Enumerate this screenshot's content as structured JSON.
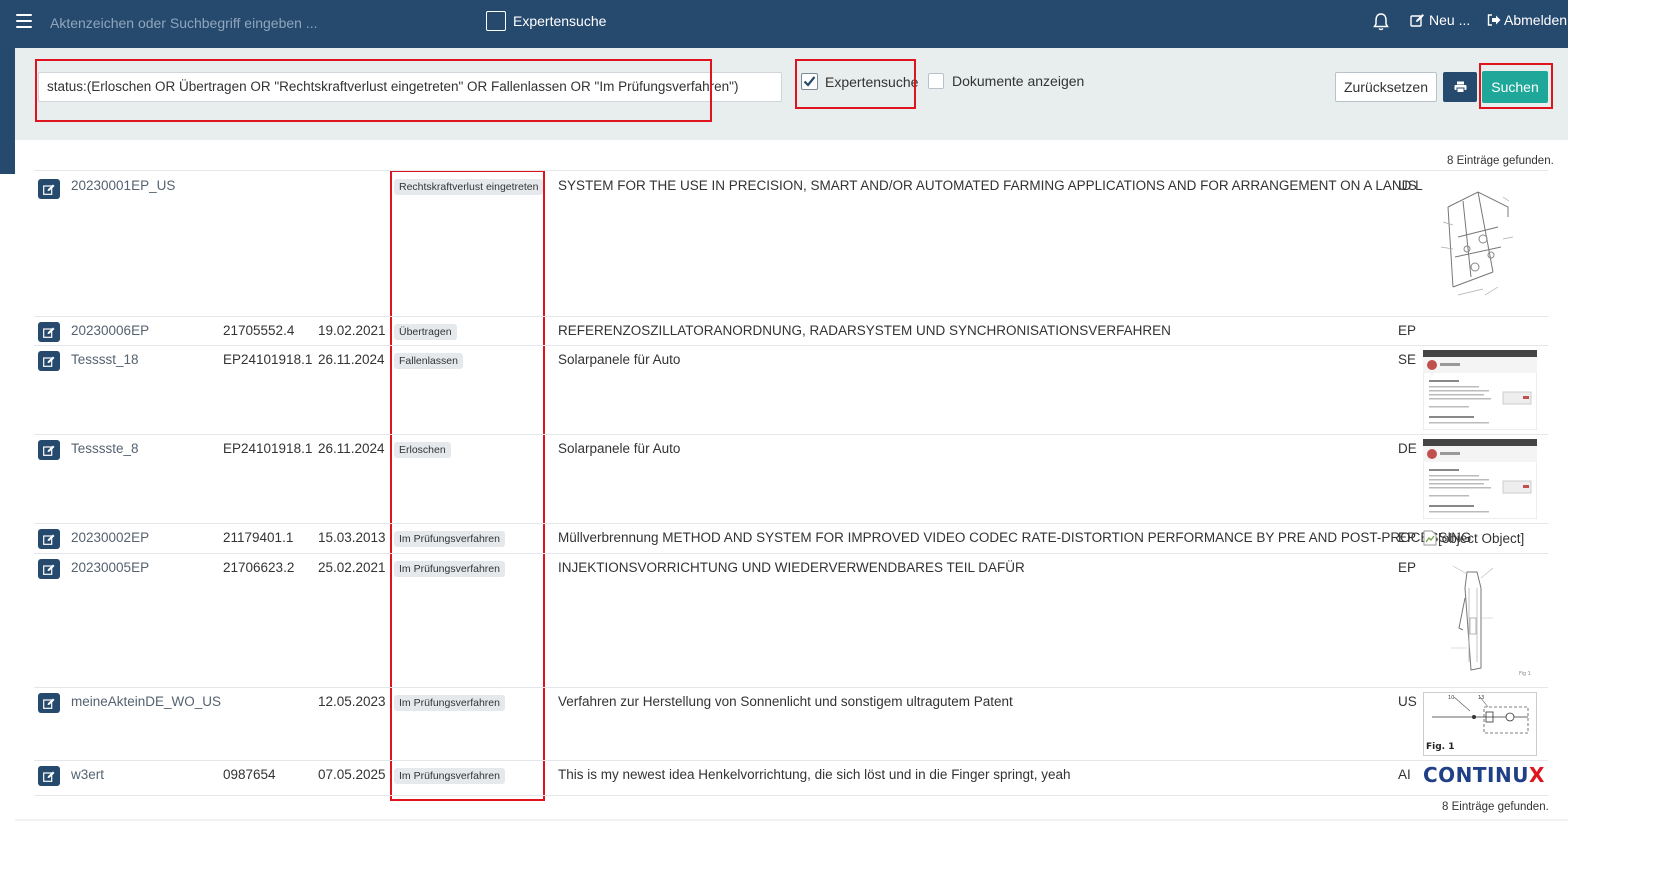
{
  "topbar": {
    "search_placeholder": "Aktenzeichen oder Suchbegriff eingeben ...",
    "expert_label": "Expertensuche",
    "new_label": "Neu ...",
    "logout_label": "Abmelden"
  },
  "search": {
    "query": "status:(Erloschen OR Übertragen OR \"Rechtskraftverlust eingetreten\" OR Fallenlassen OR \"Im Prüfungsverfahren\")",
    "expert_label": "Expertensuche",
    "expert_checked": true,
    "docs_label": "Dokumente anzeigen",
    "docs_checked": false,
    "reset_label": "Zurücksetzen",
    "search_label": "Suchen"
  },
  "results": {
    "count_text": "8 Einträge gefunden.",
    "rows": [
      {
        "aktenzeichen": "20230001EP_US",
        "application_no": "",
        "date": "",
        "status": "Rechtskraftverlust eingetreten",
        "title": "SYSTEM FOR THE USE IN PRECISION, SMART AND/OR AUTOMATED FARMING APPLICATIONS AND FOR ARRANGEMENT ON A LAND LOT",
        "country": "US",
        "thumbnail": "patent-drawing"
      },
      {
        "aktenzeichen": "20230006EP",
        "application_no": "21705552.4",
        "date": "19.02.2021",
        "status": "Übertragen",
        "title": "REFERENZOSZILLATORANORDNUNG, RADARSYSTEM UND SYNCHRONISATIONSVERFAHREN",
        "country": "EP",
        "thumbnail": ""
      },
      {
        "aktenzeichen": "Tesssst_18",
        "application_no": "EP24101918.1",
        "date": "26.11.2024",
        "status": "Fallenlassen",
        "title": "Solarpanele für Auto",
        "country": "SE",
        "thumbnail": "webpage-screenshot"
      },
      {
        "aktenzeichen": "Tesssste_8",
        "application_no": "EP24101918.1",
        "date": "26.11.2024",
        "status": "Erloschen",
        "title": "Solarpanele für Auto",
        "country": "DE",
        "thumbnail": "webpage-screenshot"
      },
      {
        "aktenzeichen": "20230002EP",
        "application_no": "21179401.1",
        "date": "15.03.2013",
        "status": "Im Prüfungsverfahren",
        "title": "Müllverbrennung METHOD AND SYSTEM FOR IMPROVED VIDEO CODEC RATE-DISTORTION PERFORMANCE BY PRE AND POST-PROCESSING",
        "country": "EP",
        "thumbnail": "broken-image",
        "thumbnail_alt": "[object Object]"
      },
      {
        "aktenzeichen": "20230005EP",
        "application_no": "21706623.2",
        "date": "25.02.2021",
        "status": "Im Prüfungsverfahren",
        "title": "INJEKTIONSVORRICHTUNG UND WIEDERVERWENDBARES TEIL DAFÜR",
        "country": "EP",
        "thumbnail": "injector-drawing"
      },
      {
        "aktenzeichen": "meineAkteinDE_WO_US",
        "application_no": "",
        "date": "12.05.2023",
        "status": "Im Prüfungsverfahren",
        "title": "Verfahren zur Herstellung von Sonnenlicht und sonstigem ultragutem Patent",
        "country": "US",
        "thumbnail": "circuit-figure",
        "thumbnail_caption": "Fig. 1"
      },
      {
        "aktenzeichen": "w3ert",
        "application_no": "0987654",
        "date": "07.05.2025",
        "status": "Im Prüfungsverfahren",
        "title": "This is my newest idea Henkelvorrichtung, die sich löst und in die Finger springt, yeah",
        "country": "AI",
        "thumbnail": "continux-logo",
        "thumbnail_logo_text": "CONTINUX"
      }
    ]
  },
  "colors": {
    "navbar": "#264a6e",
    "panel": "#e8eded",
    "search_button": "#1fa899",
    "highlight": "#e0141e"
  }
}
